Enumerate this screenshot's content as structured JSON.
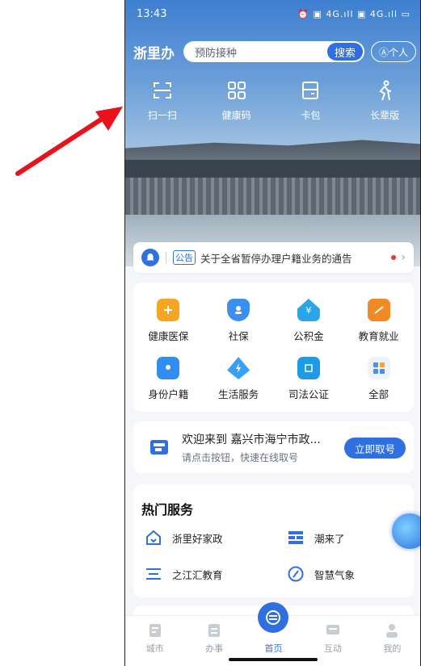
{
  "status": {
    "time": "13:43",
    "right": "⏰ ▣ 4G.ıll ▣ 4G.ıll ▭"
  },
  "header": {
    "brand": "浙里办",
    "search_placeholder": "预防接种",
    "search_button": "搜索",
    "personal": "Ⓐ个人"
  },
  "quick": [
    {
      "label": "扫一扫",
      "icon": "scan-icon"
    },
    {
      "label": "健康码",
      "icon": "health-code-icon"
    },
    {
      "label": "卡包",
      "icon": "card-wallet-icon"
    },
    {
      "label": "长辈版",
      "icon": "elder-mode-icon"
    }
  ],
  "notice": {
    "tag": "公告",
    "text": "关于全省暂停办理户籍业务的通告"
  },
  "services": [
    {
      "label": "健康医保",
      "color": "#f5a623"
    },
    {
      "label": "社保",
      "color": "#3a8ff0"
    },
    {
      "label": "公积金",
      "color": "#2aa6e8"
    },
    {
      "label": "教育就业",
      "color": "#f08a24"
    },
    {
      "label": "身份户籍",
      "color": "#2f8ef0"
    },
    {
      "label": "生活服务",
      "color": "#3aa0f5"
    },
    {
      "label": "司法公证",
      "color": "#1e9be6"
    },
    {
      "label": "全部",
      "color": "#4b8df0"
    }
  ],
  "queue": {
    "title": "欢迎来到 嘉兴市海宁市政...",
    "sub": "请点击按钮，快速在线取号",
    "button": "立即取号"
  },
  "hot": {
    "title": "热门服务",
    "items": [
      {
        "label": "浙里好家政",
        "icon": "home-care-icon"
      },
      {
        "label": "潮来了",
        "icon": "tide-icon"
      },
      {
        "label": "之江汇教育",
        "icon": "education-icon"
      },
      {
        "label": "智慧气象",
        "icon": "weather-icon"
      }
    ]
  },
  "tabs": [
    {
      "label": "城市"
    },
    {
      "label": "办事"
    },
    {
      "label": "首页"
    },
    {
      "label": "互动"
    },
    {
      "label": "我的"
    }
  ],
  "accent": "#2f6fe0",
  "annotation_color": "#e8121b"
}
